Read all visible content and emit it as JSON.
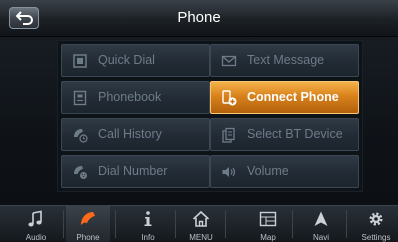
{
  "header": {
    "title": "Phone",
    "back_icon": "back-arrow-icon"
  },
  "menu": {
    "items": [
      {
        "label": "Quick Dial",
        "icon": "quick-dial-icon"
      },
      {
        "label": "Text Message",
        "icon": "envelope-icon"
      },
      {
        "label": "Phonebook",
        "icon": "phonebook-icon"
      },
      {
        "label": "Connect Phone",
        "icon": "connect-phone-icon",
        "state": "highlighted"
      },
      {
        "label": "Call History",
        "icon": "call-history-icon"
      },
      {
        "label": "Select BT Device",
        "icon": "bt-device-icon"
      },
      {
        "label": "Dial Number",
        "icon": "dial-number-icon"
      },
      {
        "label": "Volume",
        "icon": "speaker-icon"
      }
    ]
  },
  "bottom_nav": {
    "items": [
      {
        "label": "Audio",
        "icon": "music-note-icon"
      },
      {
        "label": "Phone",
        "icon": "phone-handset-icon",
        "active": true
      },
      {
        "label": "Info",
        "icon": "info-icon"
      },
      {
        "label": "MENU",
        "icon": "home-icon"
      },
      {
        "label": "Map",
        "icon": "map-icon"
      },
      {
        "label": "Navi",
        "icon": "navigation-arrow-icon"
      },
      {
        "label": "Settings",
        "icon": "gear-icon"
      }
    ]
  },
  "colors": {
    "accent": "#e8921f",
    "phone_icon": "#ff6a1a",
    "text_dim": "#6e7b88"
  }
}
